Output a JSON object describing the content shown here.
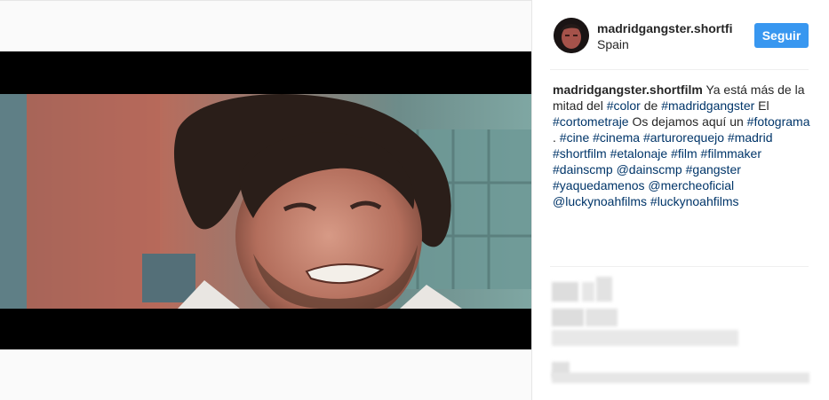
{
  "post": {
    "username": "madridgangster.shortfilm",
    "username_display": "madridgangster.shortfi",
    "location": "Spain",
    "follow_label": "Seguir",
    "caption": {
      "user": "madridgangster.shortfilm",
      "segments": [
        {
          "t": "text",
          "v": " Ya está más de la mitad del "
        },
        {
          "t": "tag",
          "v": "#color"
        },
        {
          "t": "text",
          "v": " de "
        },
        {
          "t": "tag",
          "v": "#madridgangster"
        },
        {
          "t": "text",
          "v": " El "
        },
        {
          "t": "tag",
          "v": "#cortometraje"
        },
        {
          "t": "text",
          "v": " Os dejamos aquí un "
        },
        {
          "t": "tag",
          "v": "#fotograma"
        },
        {
          "t": "text",
          "v": " . "
        },
        {
          "t": "tag",
          "v": "#cine"
        },
        {
          "t": "text",
          "v": " "
        },
        {
          "t": "tag",
          "v": "#cinema"
        },
        {
          "t": "text",
          "v": " "
        },
        {
          "t": "tag",
          "v": "#arturorequejo"
        },
        {
          "t": "text",
          "v": " "
        },
        {
          "t": "tag",
          "v": "#madrid"
        },
        {
          "t": "text",
          "v": " "
        },
        {
          "t": "tag",
          "v": "#shortfilm"
        },
        {
          "t": "text",
          "v": " "
        },
        {
          "t": "tag",
          "v": "#etalonaje"
        },
        {
          "t": "text",
          "v": " "
        },
        {
          "t": "tag",
          "v": "#film"
        },
        {
          "t": "text",
          "v": " "
        },
        {
          "t": "tag",
          "v": "#filmmaker"
        },
        {
          "t": "text",
          "v": " "
        },
        {
          "t": "tag",
          "v": "#dainscmp"
        },
        {
          "t": "text",
          "v": " "
        },
        {
          "t": "tag",
          "v": "@dainscmp"
        },
        {
          "t": "text",
          "v": " "
        },
        {
          "t": "tag",
          "v": "#gangster"
        },
        {
          "t": "text",
          "v": " "
        },
        {
          "t": "tag",
          "v": "#yaquedamenos"
        },
        {
          "t": "text",
          "v": " "
        },
        {
          "t": "tag",
          "v": "@mercheoficial"
        },
        {
          "t": "text",
          "v": " "
        },
        {
          "t": "tag",
          "v": "@luckynoahfilms"
        },
        {
          "t": "text",
          "v": " "
        },
        {
          "t": "tag",
          "v": "#luckynoahfilms"
        }
      ]
    }
  },
  "colors": {
    "follow_button": "#3897f0",
    "hashtag": "#003569",
    "text": "#262626"
  }
}
